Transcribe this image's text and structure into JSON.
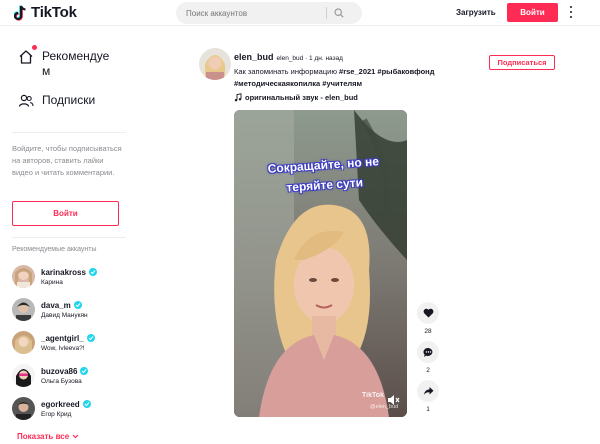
{
  "header": {
    "logo_text": "TikTok",
    "search_placeholder": "Поиск аккаунтов",
    "upload_label": "Загрузить",
    "login_label": "Войти"
  },
  "sidebar": {
    "nav": [
      {
        "label": "Рекомендуе м",
        "icon": "home-icon"
      },
      {
        "label": "Подписки",
        "icon": "people-icon"
      }
    ],
    "login_hint": "Войдите, чтобы подписываться на авторов, ставить лайки видео и читать комментарии.",
    "login_label": "Войти",
    "recommended_title": "Рекомендуемые аккаунты",
    "accounts": [
      {
        "username": "karinakross",
        "name": "Карина"
      },
      {
        "username": "dava_m",
        "name": "Давид Манукян"
      },
      {
        "username": "_agentgirl_",
        "name": "Wow, Ivleeva?!"
      },
      {
        "username": "buzova86",
        "name": "Ольга Бузова"
      },
      {
        "username": "egorkreed",
        "name": "Егор Крид"
      }
    ],
    "show_all": "Показать все"
  },
  "post": {
    "username": "elen_bud",
    "meta": "elen_bud · 1 дн. назад",
    "desc_text": "Как запоминать информацию ",
    "desc_tags_line1": "#rse_2021 #рыбаковфонд",
    "desc_tags_line2": "#методическаякопилка #учителям",
    "sound": "оригинальный звук - elen_bud",
    "follow_label": "Подписаться",
    "video_caption": "Сокращайте, но не теряйте сути",
    "watermark": "TikTok",
    "watermark_user": "@elen_bud",
    "actions": [
      {
        "icon": "heart-icon",
        "count": "28"
      },
      {
        "icon": "comment-icon",
        "count": "2"
      },
      {
        "icon": "share-icon",
        "count": "1"
      }
    ]
  },
  "colors": {
    "accent": "#fe2c55",
    "verified": "#20d5ec",
    "text": "#161823",
    "muted": "#8a8b91"
  }
}
